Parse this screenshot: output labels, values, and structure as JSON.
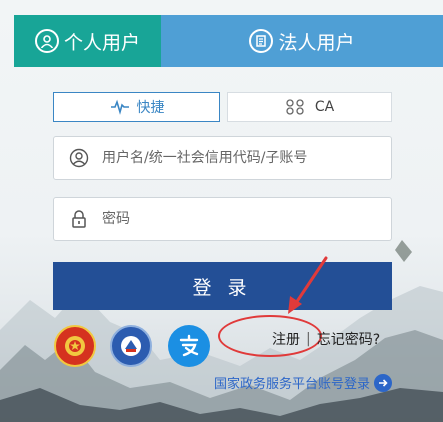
{
  "tabs": {
    "personal": "个人用户",
    "legal": "法人用户"
  },
  "methods": {
    "quick": "快捷",
    "ca": "CA"
  },
  "form": {
    "username_placeholder": "用户名/统一社会信用代码/子账号",
    "password_placeholder": "密码",
    "login_label": "登录"
  },
  "links": {
    "register": "注册",
    "separator": "|",
    "forgot_password": "忘记密码?"
  },
  "gov_link": "国家政务服务平台账号登录",
  "colors": {
    "personal_tab": "#18a597",
    "legal_tab": "#4f9fd5",
    "login_button": "#234f96",
    "highlight": "#e03a3a",
    "link": "#2c66c8"
  },
  "icons": {
    "personal": "user-circle-icon",
    "legal": "document-icon",
    "quick": "pulse-icon",
    "ca": "ca-key-icon",
    "username": "user-icon",
    "password": "lock-icon"
  }
}
